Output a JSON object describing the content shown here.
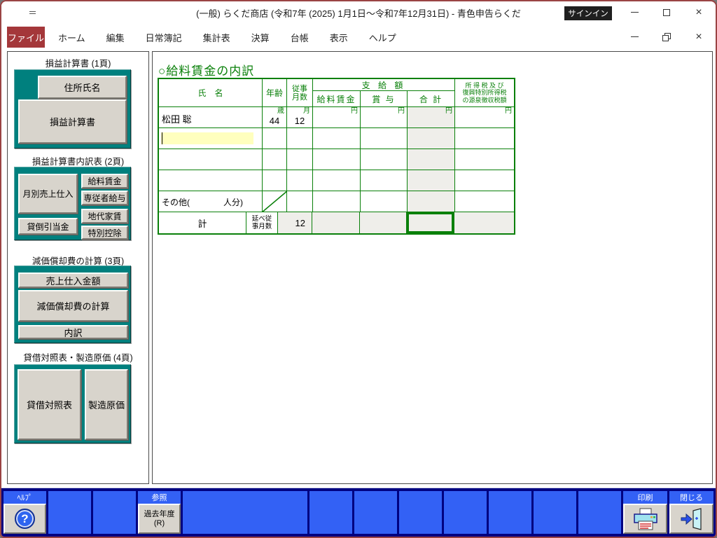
{
  "titlebar": {
    "title": "(一般) らくだ商店 (令和7年 (2025) 1月1日～令和7年12月31日)  -  青色申告らくだ",
    "signin": "サインイン"
  },
  "menubar": {
    "file": "ファイル",
    "items": [
      "ホーム",
      "編集",
      "日常簿記",
      "集計表",
      "決算",
      "台帳",
      "表示",
      "ヘルプ"
    ]
  },
  "sidebar": {
    "section1": {
      "header": "損益計算書 (1頁)",
      "btn_address": "住所氏名",
      "btn_pl": "損益計算書"
    },
    "section2": {
      "header": "損益計算書内訳表 (2頁)",
      "btn_monthly": "月別売上仕入",
      "btn_salary": "給料賃金",
      "btn_family": "専従者給与",
      "btn_rent": "地代家賃",
      "btn_special": "特別控除",
      "btn_allowance": "貸倒引当金"
    },
    "section3": {
      "header": "減価償却費の計算 (3頁)",
      "btn_amount": "売上仕入金額",
      "btn_depreciation": "減価償却費の計算",
      "btn_detail": "内訳"
    },
    "section4": {
      "header": "貸借対照表・製造原価 (4頁)",
      "btn_bs": "貸借対照表",
      "btn_cost": "製造原価"
    }
  },
  "main": {
    "title": "○給料賃金の内訳",
    "table": {
      "col_name": "氏　名",
      "col_age": "年齢",
      "col_months_1": "従事",
      "col_months_2": "月数",
      "group_payment": "支 給 額",
      "col_salary": "給料賃金",
      "col_bonus": "賞 与",
      "col_total": "合 計",
      "col_tax_1": "所 得 税 及 び",
      "col_tax_2": "復興特別所得税",
      "col_tax_3": "の源泉徴収税額",
      "unit_age": "歳",
      "unit_month": "月",
      "unit_yen": "円",
      "row1": {
        "name": "松田 聡",
        "age": "44",
        "months": "12"
      },
      "other_label": "その他(　　　　人分)",
      "total_label": "計",
      "total_sub_1": "延べ従",
      "total_sub_2": "事月数",
      "total_months": "12"
    }
  },
  "toolbar": {
    "help_label": "ﾍﾙﾌﾟ",
    "help_icon": "?",
    "ref_label": "参照",
    "ref_btn_1": "過去年度",
    "ref_btn_2": "(R)",
    "print_label": "印刷",
    "close_label": "閉じる"
  },
  "colors": {
    "accent_green": "#0a800a",
    "teal": "#00807e",
    "toolbar_blue": "#3361f5",
    "toolbar_navy": "#000080",
    "file_tab_red": "#a4373a",
    "frame_maroon": "#9a4444",
    "highlight_yellow": "#ffffbe",
    "readonly_gray": "#efeeea",
    "button_face": "#d8d4cc"
  }
}
